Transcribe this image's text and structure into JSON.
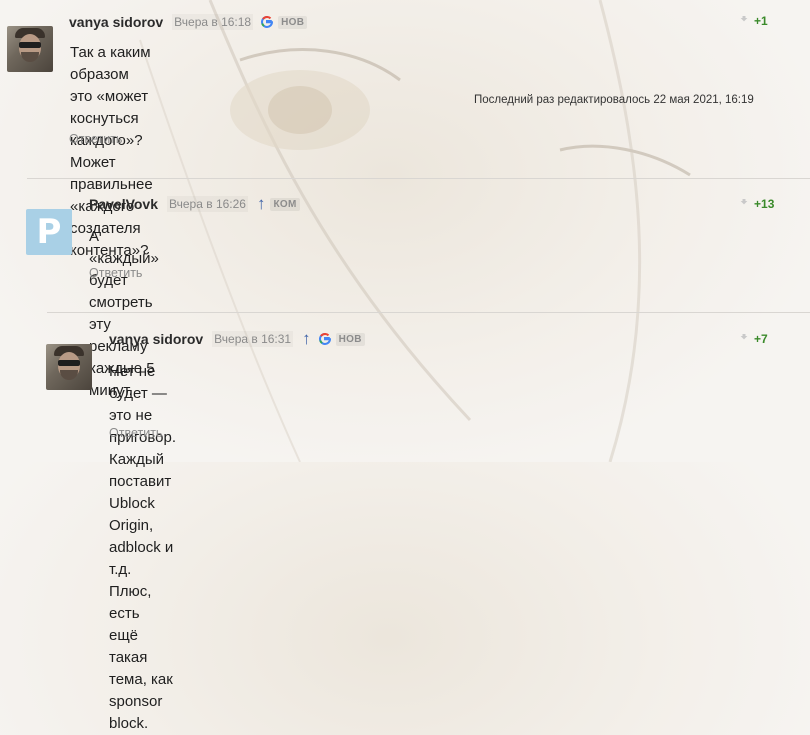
{
  "comments": [
    {
      "author": "vanya sidorov",
      "time": "Вчера в 16:18",
      "badge": "НОВ",
      "show_arrow": false,
      "text_lines": [
        "Так а каким образом это «может коснуться каждого»?",
        "Может правильнее «каждого создателя контента»?"
      ],
      "edit_note": "Последний раз редактировалось 22 мая 2021, 16:19",
      "reply_label": "Ответить",
      "score": "+1",
      "avatar_type": "photo"
    },
    {
      "author": "PavelVovk",
      "time": "Вчера в 16:26",
      "badge": "КОМ",
      "show_arrow": true,
      "text_lines": [
        "А «каждый» будет смотреть эту рекламу каждые 5 минут."
      ],
      "reply_label": "Ответить",
      "score": "+13",
      "avatar_type": "letter",
      "avatar_letter": "P"
    },
    {
      "author": "vanya sidorov",
      "time": "Вчера в 16:31",
      "badge": "НОВ",
      "show_arrow": true,
      "text_lines": [
        "Нет не будет — это не приговор. Каждый поставит Ublock Origin, adblock и т.д. Плюс, есть",
        "ещё такая тема, как sponsor block."
      ],
      "reply_label": "Ответить",
      "score": "+7",
      "avatar_type": "photo"
    }
  ],
  "icons": {
    "vote_down": "down-arrow-icon",
    "reply_arrow": "up-arrow-icon",
    "google": "google-icon"
  },
  "colors": {
    "score_positive": "#3a8a2a",
    "arrow_up": "#3f63a8",
    "avatar_letter_bg": "#a9d0e6"
  }
}
